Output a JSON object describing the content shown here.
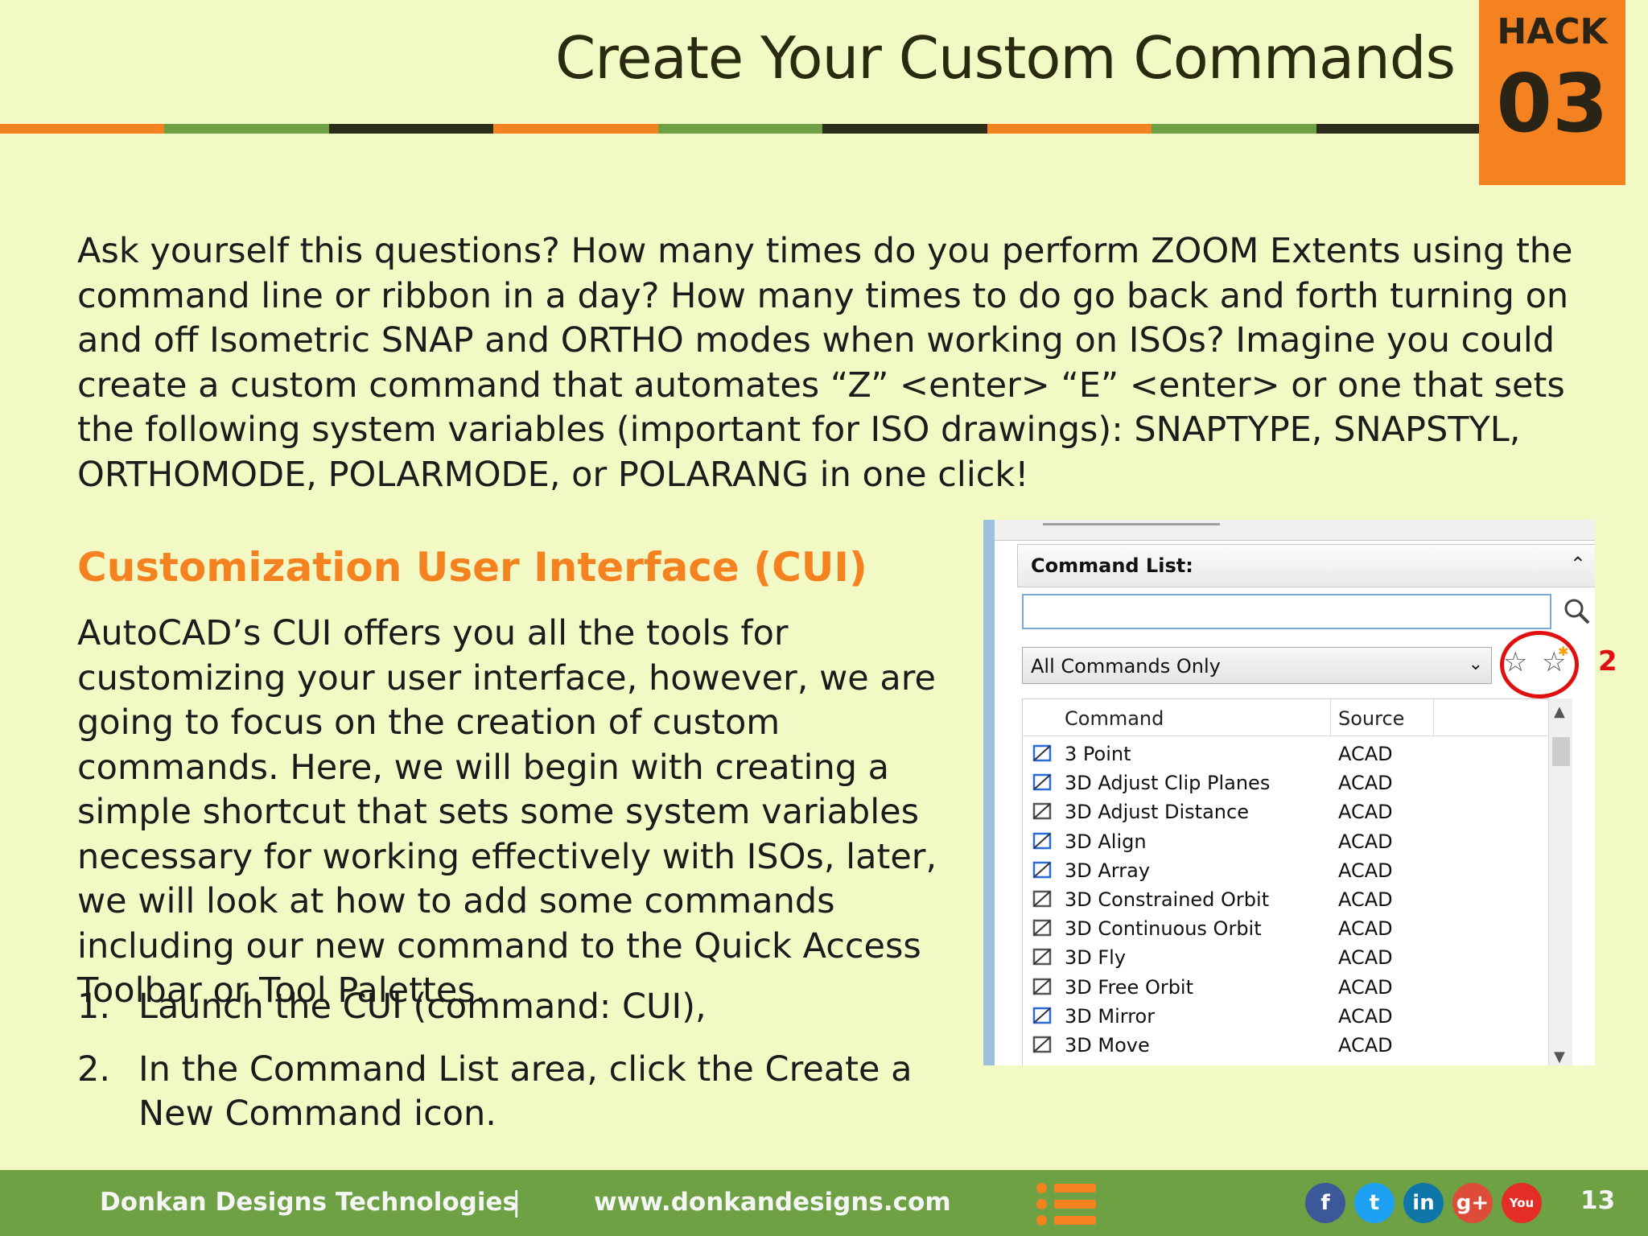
{
  "slide": {
    "title": "Create Your Custom Commands",
    "hack_label": "HACK",
    "hack_number": "03",
    "stripe_colors": [
      "#f58220",
      "#6da144",
      "#2b2d19",
      "#f58220",
      "#6da144",
      "#2b2d19",
      "#f58220",
      "#6da144",
      "#2b2d19"
    ]
  },
  "intro": "Ask yourself this questions? How many times do you perform ZOOM Extents using the command line or ribbon in a day? How many times to do go back and forth turning on and off Isometric SNAP and ORTHO modes when working on ISOs? Imagine you could create a custom command that automates “Z” <enter> “E” <enter> or one that sets the following system variables (important for ISO drawings): SNAPTYPE, SNAPSTYL, ORTHOMODE, POLARMODE, or POLARANG in one click!",
  "section": {
    "heading": "Customization User Interface (CUI)",
    "paragraph": "AutoCAD’s CUI offers you all the tools for customizing your user interface, however, we are going to focus on the creation of custom commands. Here, we will begin with creating a simple shortcut that sets some system variables necessary for working effectively with ISOs, later, we will look at how to add some commands including our new command to the Quick Access Toolbar or Tool Palettes.",
    "steps": [
      {
        "num": "1.",
        "text": "Launch the CUI (command: CUI),"
      },
      {
        "num": "2.",
        "text": "In the Command List area, click the Create a New Command icon."
      }
    ]
  },
  "command_list": {
    "header_label": "Command List:",
    "search_value": "",
    "filter_value": "All Commands Only",
    "callout_number": "2",
    "columns": {
      "command": "Command",
      "source": "Source"
    },
    "rows": [
      {
        "command": "3 Point",
        "source": "ACAD",
        "icon": "ucs-3point-icon"
      },
      {
        "command": "3D Adjust Clip Planes",
        "source": "ACAD",
        "icon": "clip-planes-icon"
      },
      {
        "command": "3D Adjust Distance",
        "source": "ACAD",
        "icon": "adjust-distance-icon"
      },
      {
        "command": "3D Align",
        "source": "ACAD",
        "icon": "align-icon"
      },
      {
        "command": "3D Array",
        "source": "ACAD",
        "icon": "array-icon"
      },
      {
        "command": "3D Constrained Orbit",
        "source": "ACAD",
        "icon": "constrained-orbit-icon"
      },
      {
        "command": "3D Continuous Orbit",
        "source": "ACAD",
        "icon": "continuous-orbit-icon"
      },
      {
        "command": "3D Fly",
        "source": "ACAD",
        "icon": "fly-icon"
      },
      {
        "command": "3D Free Orbit",
        "source": "ACAD",
        "icon": "free-orbit-icon"
      },
      {
        "command": "3D Mirror",
        "source": "ACAD",
        "icon": "mirror-icon"
      },
      {
        "command": "3D Move",
        "source": "ACAD",
        "icon": "move-icon"
      }
    ]
  },
  "footer": {
    "company": "Donkan Designs Technologies",
    "separator": "|",
    "url": "www.donkandesigns.com",
    "page_number": "13",
    "social": [
      {
        "icon": "facebook-icon",
        "glyph": "f",
        "color": "#3b5998"
      },
      {
        "icon": "twitter-icon",
        "glyph": "t",
        "color": "#1da1f2"
      },
      {
        "icon": "linkedin-icon",
        "glyph": "in",
        "color": "#0e76a8"
      },
      {
        "icon": "googleplus-icon",
        "glyph": "g+",
        "color": "#dd4b39"
      },
      {
        "icon": "youtube-icon",
        "glyph": "You",
        "color": "#e52d27"
      }
    ]
  }
}
